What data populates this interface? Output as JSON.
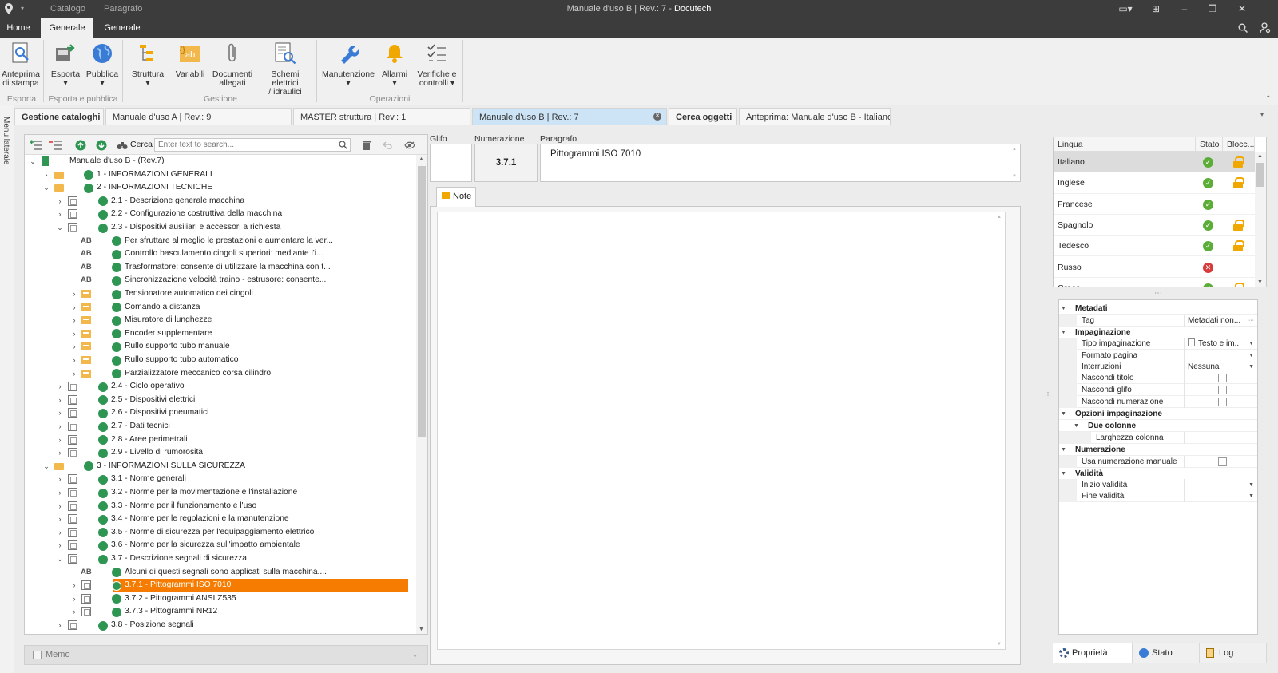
{
  "window": {
    "title_prefix": "Manuale d'uso B | Rev.: 7 - ",
    "app_name": "Docutech",
    "tabs": [
      "Catalogo",
      "Paragrafo"
    ],
    "controls": [
      "▭▾",
      "⊞",
      "–",
      "❐",
      "✕"
    ]
  },
  "menu": {
    "tabs": [
      "Home",
      "Generale",
      "Generale"
    ],
    "active": 1
  },
  "ribbon": {
    "buttons": [
      {
        "label": "Anteprima\ndi stampa",
        "icon": "print-preview-icon"
      },
      {
        "label": "Esporta\n▾",
        "icon": "export-icon"
      },
      {
        "label": "Pubblica\n▾",
        "icon": "globe-icon"
      },
      {
        "label": "Struttura\n▾",
        "icon": "structure-icon"
      },
      {
        "label": "Variabili",
        "icon": "variables-icon"
      },
      {
        "label": "Documenti\nallegati",
        "icon": "paperclip-icon"
      },
      {
        "label": "Schemi elettrici\n/ idraulici",
        "icon": "schematics-icon"
      },
      {
        "label": "Manutenzione\n▾",
        "icon": "wrench-icon"
      },
      {
        "label": "Allarmi\n▾",
        "icon": "bell-icon"
      },
      {
        "label": "Verifiche e\ncontrolli ▾",
        "icon": "checklist-icon"
      }
    ],
    "groups": [
      "Esporta",
      "Esporta e pubblica",
      "Gestione",
      "Operazioni"
    ]
  },
  "side_label": "Menu laterale",
  "doctabs": [
    "Gestione cataloghi",
    "Manuale d'uso A | Rev.: 9",
    "MASTER struttura | Rev.: 1",
    "Manuale d'uso B | Rev.: 7",
    "Cerca oggetti",
    "Anteprima: Manuale d'uso B - Italiano"
  ],
  "tree_toolbar": {
    "search_label": "Cerca",
    "search_placeholder": "Enter text to search..."
  },
  "tree": [
    {
      "label": "Manuale d'uso B - (Rev.7)",
      "lvl": 0,
      "chev": "⌄",
      "icon": "book",
      "dot": false
    },
    {
      "label": "1 - INFORMAZIONI GENERALI",
      "lvl": 1,
      "chev": "›",
      "icon": "folder",
      "dot": true
    },
    {
      "label": "2 - INFORMAZIONI TECNICHE",
      "lvl": 1,
      "chev": "⌄",
      "icon": "folder",
      "dot": true
    },
    {
      "label": "2.1 - Descrizione generale macchina",
      "lvl": 2,
      "chev": "›",
      "icon": "doc",
      "dot": true
    },
    {
      "label": "2.2 - Configurazione costruttiva della macchina",
      "lvl": 2,
      "chev": "›",
      "icon": "doc",
      "dot": true
    },
    {
      "label": "2.3 - Dispositivi ausiliari e accessori a richiesta",
      "lvl": 2,
      "chev": "⌄",
      "icon": "doc",
      "dot": true
    },
    {
      "label": "Per sfruttare al meglio le prestazioni e aumentare la ver...",
      "lvl": 3,
      "chev": "",
      "icon": "AB",
      "dot": true
    },
    {
      "label": "Controllo basculamento cingoli superiori: mediante l'i...",
      "lvl": 3,
      "chev": "",
      "icon": "AB",
      "dot": true
    },
    {
      "label": "Trasformatore: consente di utilizzare la macchina con t...",
      "lvl": 3,
      "chev": "",
      "icon": "AB",
      "dot": true
    },
    {
      "label": "Sincronizzazione velocità traino - estrusore: consente...",
      "lvl": 3,
      "chev": "",
      "icon": "AB",
      "dot": true
    },
    {
      "label": "Tensionatore automatico dei cingoli",
      "lvl": 3,
      "chev": "›",
      "icon": "sect",
      "dot": true
    },
    {
      "label": "Comando a distanza",
      "lvl": 3,
      "chev": "›",
      "icon": "sect",
      "dot": true
    },
    {
      "label": "Misuratore di lunghezze",
      "lvl": 3,
      "chev": "›",
      "icon": "sect",
      "dot": true
    },
    {
      "label": "Encoder supplementare",
      "lvl": 3,
      "chev": "›",
      "icon": "sect",
      "dot": true
    },
    {
      "label": "Rullo supporto tubo manuale",
      "lvl": 3,
      "chev": "›",
      "icon": "sect",
      "dot": true
    },
    {
      "label": "Rullo supporto tubo automatico",
      "lvl": 3,
      "chev": "›",
      "icon": "sect",
      "dot": true
    },
    {
      "label": "Parzializzatore meccanico corsa cilindro",
      "lvl": 3,
      "chev": "›",
      "icon": "sect",
      "dot": true
    },
    {
      "label": "2.4 - Ciclo operativo",
      "lvl": 2,
      "chev": "›",
      "icon": "doc",
      "dot": true
    },
    {
      "label": "2.5 - Dispositivi elettrici",
      "lvl": 2,
      "chev": "›",
      "icon": "doc",
      "dot": true
    },
    {
      "label": "2.6 - Dispositivi pneumatici",
      "lvl": 2,
      "chev": "›",
      "icon": "doc",
      "dot": true
    },
    {
      "label": "2.7 - Dati tecnici",
      "lvl": 2,
      "chev": "›",
      "icon": "doc",
      "dot": true
    },
    {
      "label": "2.8 - Aree perimetrali",
      "lvl": 2,
      "chev": "›",
      "icon": "doc",
      "dot": true
    },
    {
      "label": "2.9 - Livello di rumorosità",
      "lvl": 2,
      "chev": "›",
      "icon": "doc",
      "dot": true
    },
    {
      "label": "3 - INFORMAZIONI SULLA SICUREZZA",
      "lvl": 1,
      "chev": "⌄",
      "icon": "folder",
      "dot": true
    },
    {
      "label": "3.1 - Norme generali",
      "lvl": 2,
      "chev": "›",
      "icon": "doc",
      "dot": true
    },
    {
      "label": "3.2 - Norme per la movimentazione e l'installazione",
      "lvl": 2,
      "chev": "›",
      "icon": "doc",
      "dot": true
    },
    {
      "label": "3.3 - Norme per il funzionamento e l'uso",
      "lvl": 2,
      "chev": "›",
      "icon": "doc",
      "dot": true
    },
    {
      "label": "3.4 - Norme per le regolazioni e la manutenzione",
      "lvl": 2,
      "chev": "›",
      "icon": "doc",
      "dot": true
    },
    {
      "label": "3.5 - Norme di sicurezza per l'equipaggiamento elettrico",
      "lvl": 2,
      "chev": "›",
      "icon": "doc",
      "dot": true
    },
    {
      "label": "3.6 - Norme per la sicurezza sull'impatto ambientale",
      "lvl": 2,
      "chev": "›",
      "icon": "doc",
      "dot": true
    },
    {
      "label": "3.7 - Descrizione segnali di sicurezza",
      "lvl": 2,
      "chev": "⌄",
      "icon": "doc",
      "dot": true
    },
    {
      "label": "Alcuni di questi segnali sono applicati sulla macchina....",
      "lvl": 3,
      "chev": "",
      "icon": "AB",
      "dot": true
    },
    {
      "label": "3.7.1 - Pittogrammi ISO 7010",
      "lvl": 3,
      "chev": "›",
      "icon": "doc",
      "dot": true,
      "selected": true
    },
    {
      "label": "3.7.2 - Pittogrammi ANSI Z535",
      "lvl": 3,
      "chev": "›",
      "icon": "doc",
      "dot": true
    },
    {
      "label": "3.7.3 - Pittogrammi NR12",
      "lvl": 3,
      "chev": "›",
      "icon": "doc",
      "dot": true
    },
    {
      "label": "3.8 - Posizione segnali",
      "lvl": 2,
      "chev": "›",
      "icon": "doc",
      "dot": true
    }
  ],
  "memo": {
    "label": "Memo"
  },
  "editor": {
    "glifo_label": "Glifo",
    "numerazione_label": "Numerazione",
    "numerazione_value": "3.7.1",
    "paragrafo_label": "Paragrafo",
    "paragrafo_value": "Pittogrammi ISO 7010",
    "note_tab": "Note"
  },
  "languages": {
    "headers": [
      "Lingua",
      "Stato",
      "Blocc..."
    ],
    "rows": [
      {
        "name": "Italiano",
        "status": "ok",
        "locked": true
      },
      {
        "name": "Inglese",
        "status": "ok",
        "locked": true
      },
      {
        "name": "Francese",
        "status": "ok",
        "locked": false
      },
      {
        "name": "Spagnolo",
        "status": "ok",
        "locked": true
      },
      {
        "name": "Tedesco",
        "status": "ok",
        "locked": true
      },
      {
        "name": "Russo",
        "status": "error",
        "locked": false
      },
      {
        "name": "Greco",
        "status": "ok",
        "locked": true
      }
    ]
  },
  "properties": [
    {
      "label": "Metadati",
      "type": "cat",
      "lvl": 0
    },
    {
      "label": "Tag",
      "value": "Metadati non...",
      "type": "more",
      "lvl": 1
    },
    {
      "label": "Impaginazione",
      "type": "cat",
      "lvl": 0
    },
    {
      "label": "Tipo impaginazione",
      "value": "Testo e im...",
      "type": "drop",
      "lvl": 1
    },
    {
      "label": "Formato pagina",
      "value": "",
      "type": "drop",
      "lvl": 1
    },
    {
      "label": "Interruzioni",
      "value": "Nessuna",
      "type": "drop",
      "lvl": 1
    },
    {
      "label": "Nascondi titolo",
      "type": "chk",
      "lvl": 1
    },
    {
      "label": "Nascondi glifo",
      "type": "chk",
      "lvl": 1
    },
    {
      "label": "Nascondi numerazione",
      "type": "chk",
      "lvl": 1
    },
    {
      "label": "Opzioni impaginazione",
      "type": "cat",
      "lvl": 0
    },
    {
      "label": "Due colonne",
      "type": "cat",
      "lvl": 1
    },
    {
      "label": "Larghezza colonna",
      "value": "",
      "type": "text",
      "lvl": 2
    },
    {
      "label": "Numerazione",
      "type": "cat",
      "lvl": 0
    },
    {
      "label": "Usa numerazione manuale",
      "type": "chk",
      "lvl": 1
    },
    {
      "label": "Validità",
      "type": "cat",
      "lvl": 0
    },
    {
      "label": "Inizio validità",
      "value": "",
      "type": "drop",
      "lvl": 1
    },
    {
      "label": "Fine validità",
      "value": "",
      "type": "drop",
      "lvl": 1
    }
  ],
  "bottom_tabs": [
    "Proprietà",
    "Stato",
    "Log"
  ],
  "colors": {
    "accent": "#f57c00",
    "green": "#2e9652",
    "dark": "#3c3c3c",
    "lock": "#f0a800"
  }
}
